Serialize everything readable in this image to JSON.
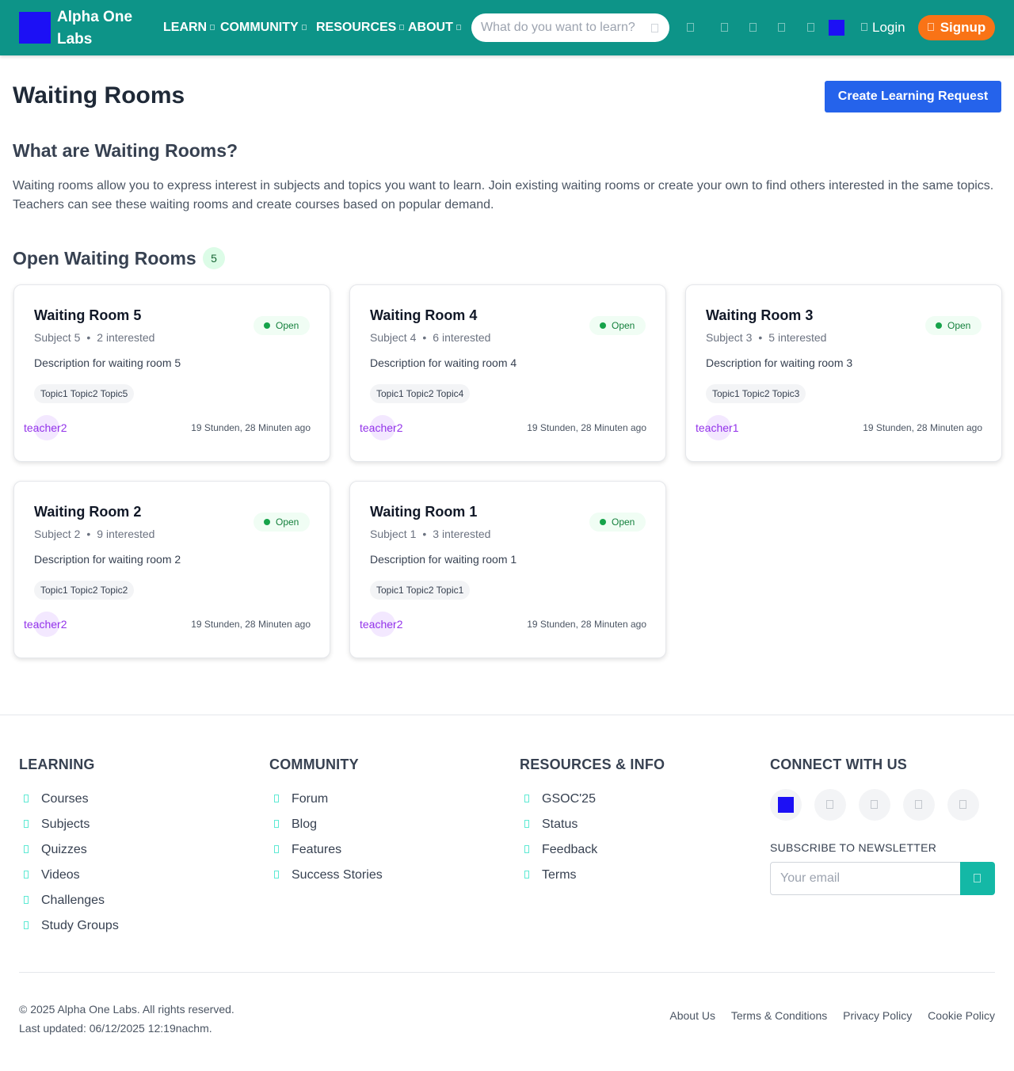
{
  "header": {
    "brand": "Alpha One Labs",
    "nav": [
      "LEARN",
      "COMMUNITY",
      "RESOURCES",
      "ABOUT"
    ],
    "search_placeholder": "What do you want to learn?",
    "login": "Login",
    "signup": "Signup",
    "accent": "#0d9488",
    "signup_color": "#f97316"
  },
  "main": {
    "title": "Waiting Rooms",
    "create_button": "Create Learning Request",
    "what_title": "What are Waiting Rooms?",
    "what_text": "Waiting rooms allow you to express interest in subjects and topics you want to learn. Join existing waiting rooms or create your own to find others interested in the same topics. Teachers can see these waiting rooms and create courses based on popular demand.",
    "open_title": "Open Waiting Rooms",
    "open_count": "5",
    "rooms": [
      {
        "title": "Waiting Room 5",
        "subject": "Subject 5",
        "interested": "2 interested",
        "status": "Open",
        "description": "Description for waiting room 5",
        "topics": "Topic1 Topic2 Topic5",
        "teacher": "teacher2",
        "time": "19 Stunden, 28 Minuten ago"
      },
      {
        "title": "Waiting Room 4",
        "subject": "Subject 4",
        "interested": "6 interested",
        "status": "Open",
        "description": "Description for waiting room 4",
        "topics": "Topic1 Topic2 Topic4",
        "teacher": "teacher2",
        "time": "19 Stunden, 28 Minuten ago"
      },
      {
        "title": "Waiting Room 3",
        "subject": "Subject 3",
        "interested": "5 interested",
        "status": "Open",
        "description": "Description for waiting room 3",
        "topics": "Topic1 Topic2 Topic3",
        "teacher": "teacher1",
        "time": "19 Stunden, 28 Minuten ago"
      },
      {
        "title": "Waiting Room 2",
        "subject": "Subject 2",
        "interested": "9 interested",
        "status": "Open",
        "description": "Description for waiting room 2",
        "topics": "Topic1 Topic2 Topic2",
        "teacher": "teacher2",
        "time": "19 Stunden, 28 Minuten ago"
      },
      {
        "title": "Waiting Room 1",
        "subject": "Subject 1",
        "interested": "3 interested",
        "status": "Open",
        "description": "Description for waiting room 1",
        "topics": "Topic1 Topic2 Topic1",
        "teacher": "teacher2",
        "time": "19 Stunden, 28 Minuten ago"
      }
    ]
  },
  "footer": {
    "learning": {
      "title": "LEARNING",
      "items": [
        "Courses",
        "Subjects",
        "Quizzes",
        "Videos",
        "Challenges",
        "Study Groups"
      ]
    },
    "community": {
      "title": "COMMUNITY",
      "items": [
        "Forum",
        "Blog",
        "Features",
        "Success Stories"
      ]
    },
    "resources": {
      "title": "RESOURCES & INFO",
      "items": [
        "GSOC'25",
        "Status",
        "Feedback",
        "Terms"
      ]
    },
    "connect": {
      "title": "CONNECT WITH US"
    },
    "newsletter_label": "SUBSCRIBE TO NEWSLETTER",
    "email_placeholder": "Your email",
    "copyright": "© 2025 Alpha One Labs. All rights reserved.",
    "last_updated": "Last updated: 06/12/2025 12:19nachm.",
    "links": [
      "About Us",
      "Terms & Conditions",
      "Privacy Policy",
      "Cookie Policy"
    ]
  }
}
